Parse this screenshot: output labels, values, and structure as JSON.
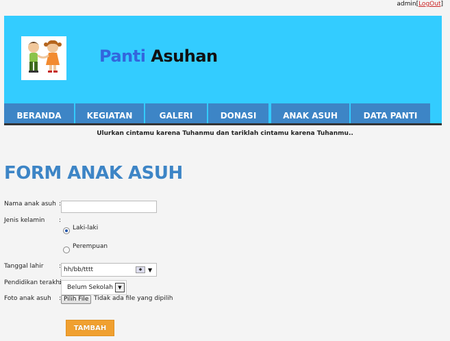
{
  "topbar": {
    "user": "admin",
    "logout_open": "[",
    "logout_label": "LogOut",
    "logout_close": "]"
  },
  "header": {
    "title_part1": "Panti",
    "title_part2": "Asuhan",
    "logo_icon": "children-holding-hands-logo",
    "bg_color": "#33ccff"
  },
  "nav": {
    "items": [
      {
        "label": "BERANDA"
      },
      {
        "label": "KEGIATAN"
      },
      {
        "label": "GALERI"
      },
      {
        "label": "DONASI"
      },
      {
        "label": "ANAK ASUH"
      },
      {
        "label": "DATA PANTI"
      }
    ],
    "item_color": "#3d85c6"
  },
  "tagline": "Ulurkan cintamu karena Tuhanmu dan tariklah cintamu karena Tuhanmu..",
  "form": {
    "title": "FORM ANAK ASUH",
    "fields": {
      "nama_label": "Nama anak asuh",
      "nama_value": "",
      "jenis_label": "Jenis kelamin",
      "jenis_options": [
        "Laki-laki",
        "Perempuan"
      ],
      "jenis_selected": "Laki-laki",
      "tanggal_label": "Tanggal lahir",
      "tanggal_placeholder": "hh/bb/tttt",
      "pendidikan_label": "Pendidikan terakhir",
      "pendidikan_value": "Belum Sekolah",
      "foto_label": "Foto anak asuh",
      "foto_button": "Pilih File",
      "foto_status": "Tidak ada file yang dipilih"
    },
    "colon": ":",
    "submit_label": "TAMBAH",
    "submit_color": "#f0a030"
  }
}
